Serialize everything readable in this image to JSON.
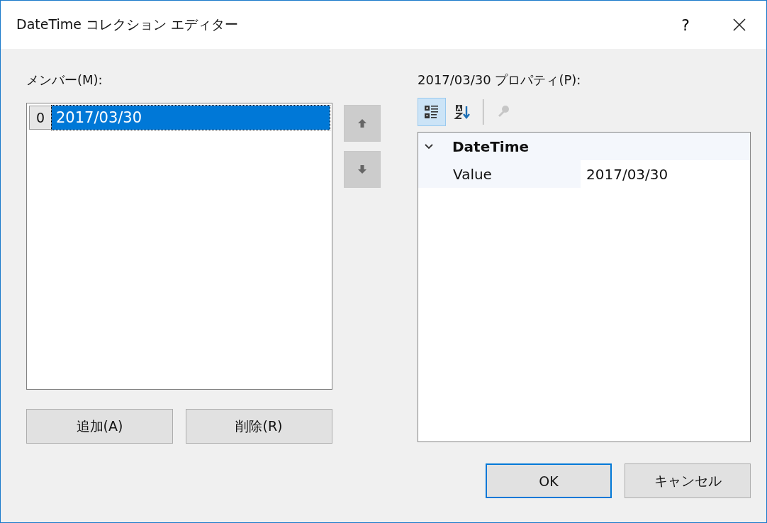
{
  "window": {
    "title": "DateTime コレクション エディター",
    "help": "?"
  },
  "members": {
    "label": "メンバー(M):",
    "items": [
      {
        "index": "0",
        "value": "2017/03/30",
        "selected": true
      }
    ]
  },
  "buttons_left": [
    "追加(A)",
    "削除(R)"
  ],
  "properties": {
    "label": "2017/03/30 プロパティ(P):",
    "toolbar": [
      {
        "kind": "categorized",
        "selected": true,
        "disabled": false
      },
      {
        "kind": "alphabetical",
        "selected": false,
        "disabled": false
      },
      {
        "kind": "property_pages",
        "selected": false,
        "disabled": true
      }
    ],
    "categories": [
      {
        "name": "DateTime",
        "expanded": true,
        "properties": [
          {
            "name": "Value",
            "value": "2017/03/30"
          }
        ]
      }
    ]
  },
  "buttons_bottom": [
    {
      "label": "OK",
      "default": true
    },
    {
      "label": "キャンセル",
      "default": false
    }
  ]
}
